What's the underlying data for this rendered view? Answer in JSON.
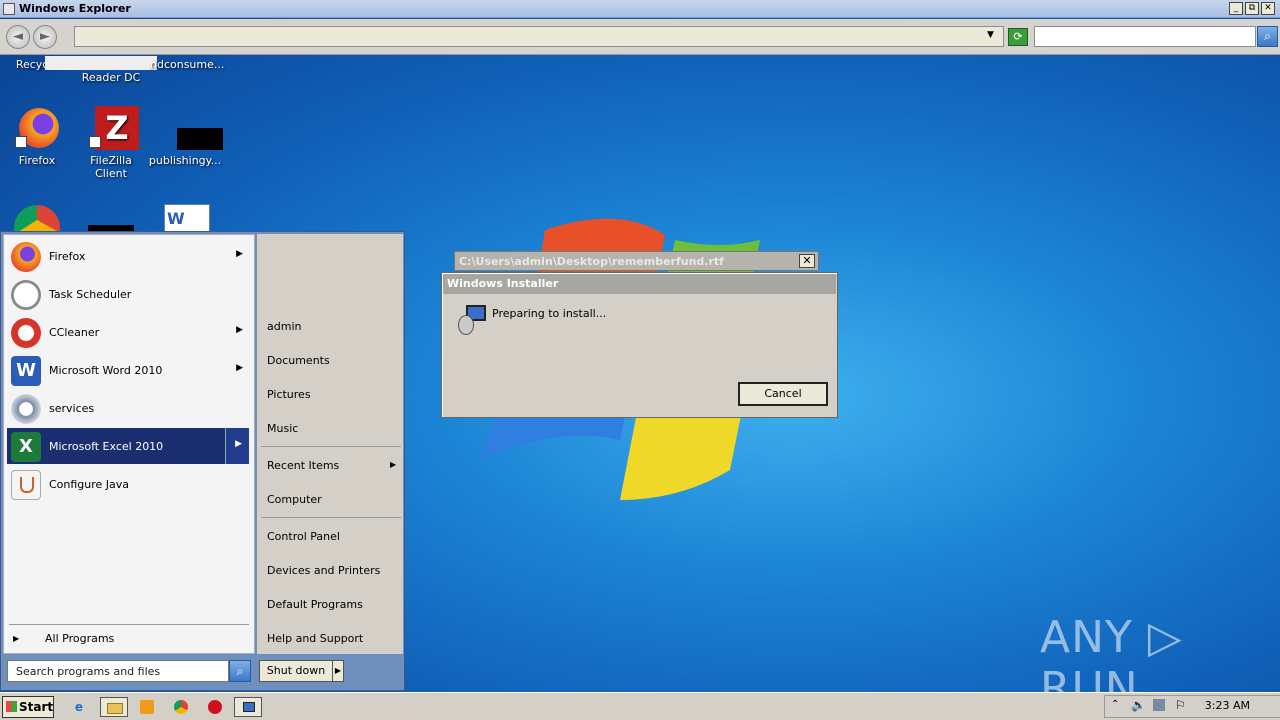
{
  "window": {
    "title": "Windows Explorer",
    "minimize": "_",
    "maximize": "⧉",
    "close": "✕"
  },
  "addressbar": {
    "back": "◄",
    "forward": "►",
    "address": "",
    "search_placeholder": "",
    "dropdown": "▼",
    "refresh": "⟳",
    "search_go": "⌕"
  },
  "desktop_icons": [
    {
      "label": "Recycle",
      "name": "recycle-bin"
    },
    {
      "label": "Reader DC",
      "name": "reader-dc"
    },
    {
      "label": "ndconsume...",
      "name": "ndconsume-file"
    },
    {
      "label": "Firefox",
      "name": "firefox"
    },
    {
      "label": "FileZilla Client",
      "name": "filezilla"
    },
    {
      "label": "publishingy...",
      "name": "publishing-file"
    }
  ],
  "startmenu": {
    "programs": [
      {
        "label": "Firefox",
        "has_arrow": true,
        "color": "#f06a1e"
      },
      {
        "label": "Task Scheduler",
        "has_arrow": false,
        "color": "#9a9a9a"
      },
      {
        "label": "CCleaner",
        "has_arrow": true,
        "color": "#d8332a"
      },
      {
        "label": "Microsoft Word 2010",
        "has_arrow": true,
        "color": "#2b5cb8"
      },
      {
        "label": "services",
        "has_arrow": false,
        "color": "#7a8aa0"
      },
      {
        "label": "Microsoft Excel 2010",
        "has_arrow": true,
        "color": "#1e7a3a"
      },
      {
        "label": "Configure Java",
        "has_arrow": false,
        "color": "#c8642a"
      }
    ],
    "all_programs": "All Programs",
    "search_placeholder": "Search programs and files",
    "right_items": [
      "admin",
      "Documents",
      "Pictures",
      "Music",
      "Recent Items",
      "Computer",
      "Control Panel",
      "Devices and Printers",
      "Default Programs",
      "Help and Support"
    ],
    "shutdown": "Shut down"
  },
  "bg_dialog": {
    "title": "C:\\Users\\admin\\Desktop\\rememberfund.rtf",
    "close": "✕"
  },
  "installer": {
    "title": "Windows Installer",
    "message": "Preparing to install...",
    "cancel": "Cancel"
  },
  "taskbar": {
    "start": "Start",
    "clock": "3:23 AM"
  },
  "watermark": "ANY ▷ RUN"
}
